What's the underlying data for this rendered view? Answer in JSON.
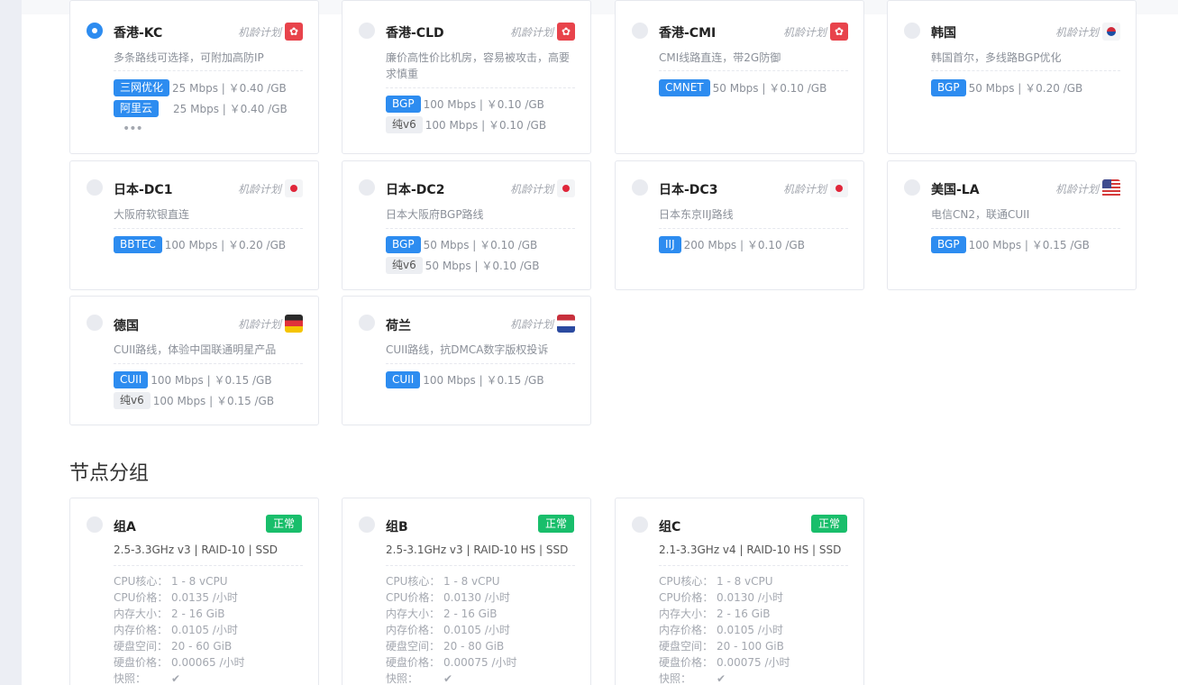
{
  "plan_label": "机龄计划",
  "flag_hk_glyph": "✿",
  "regions": [
    {
      "name": "香港-KC",
      "flag": "hk-flag-icon",
      "selected": true,
      "desc": "多条路线可选择，可附加高防IP",
      "routes": [
        {
          "tag": "三网优化",
          "style": "blue",
          "text": "25 Mbps | ￥0.40 /GB"
        },
        {
          "tag": "阿里云",
          "style": "blue",
          "text": "25 Mbps | ￥0.40 /GB"
        }
      ],
      "more": "•••"
    },
    {
      "name": "香港-CLD",
      "flag": "hk-flag-icon",
      "selected": false,
      "desc": "廉价高性价比机房，容易被攻击，高要求慎重",
      "routes": [
        {
          "tag": "BGP",
          "style": "blue",
          "text": "100 Mbps | ￥0.10 /GB"
        },
        {
          "tag": "纯v6",
          "style": "grey",
          "text": "100 Mbps | ￥0.10 /GB"
        }
      ]
    },
    {
      "name": "香港-CMI",
      "flag": "hk-flag-icon",
      "selected": false,
      "desc": "CMI线路直连，带2G防御",
      "routes": [
        {
          "tag": "CMNET",
          "style": "blue",
          "text": "50 Mbps | ￥0.10 /GB"
        }
      ]
    },
    {
      "name": "韩国",
      "flag": "kr-flag-icon",
      "selected": false,
      "desc": "韩国首尔，多线路BGP优化",
      "routes": [
        {
          "tag": "BGP",
          "style": "blue",
          "text": "50 Mbps | ￥0.20 /GB"
        }
      ]
    },
    {
      "name": "日本-DC1",
      "flag": "jp-flag-icon",
      "selected": false,
      "desc": "大阪府软银直连",
      "routes": [
        {
          "tag": "BBTEC",
          "style": "blue",
          "text": "100 Mbps | ￥0.20 /GB"
        }
      ]
    },
    {
      "name": "日本-DC2",
      "flag": "jp-flag-icon",
      "selected": false,
      "desc": "日本大阪府BGP路线",
      "routes": [
        {
          "tag": "BGP",
          "style": "blue",
          "text": "50 Mbps | ￥0.10 /GB"
        },
        {
          "tag": "纯v6",
          "style": "grey",
          "text": "50 Mbps | ￥0.10 /GB"
        }
      ]
    },
    {
      "name": "日本-DC3",
      "flag": "jp-flag-icon",
      "selected": false,
      "desc": "日本东京IIJ路线",
      "routes": [
        {
          "tag": "IIJ",
          "style": "blue",
          "text": "200 Mbps | ￥0.10 /GB"
        }
      ]
    },
    {
      "name": "美国-LA",
      "flag": "us-flag-icon",
      "selected": false,
      "desc": "电信CN2，联通CUII",
      "routes": [
        {
          "tag": "BGP",
          "style": "blue",
          "text": "100 Mbps | ￥0.15 /GB"
        }
      ]
    },
    {
      "name": "德国",
      "flag": "de-flag-icon",
      "selected": false,
      "desc": "CUII路线，体验中国联通明星产品",
      "routes": [
        {
          "tag": "CUII",
          "style": "blue",
          "text": "100 Mbps | ￥0.15 /GB"
        },
        {
          "tag": "纯v6",
          "style": "grey",
          "text": "100 Mbps | ￥0.15 /GB"
        }
      ]
    },
    {
      "name": "荷兰",
      "flag": "nl-flag-icon",
      "selected": false,
      "desc": "CUII路线，抗DMCA数字版权投诉",
      "routes": [
        {
          "tag": "CUII",
          "style": "blue",
          "text": "100 Mbps | ￥0.15 /GB"
        }
      ]
    }
  ],
  "node_section_title": "节点分组",
  "groups": [
    {
      "name": "组A",
      "status": "正常",
      "spec": "2.5-3.3GHz v3 | RAID-10 | SSD",
      "rows": [
        [
          "CPU核心：",
          "1 - 8 vCPU"
        ],
        [
          "CPU价格：",
          "0.0135 /小时"
        ],
        [
          "内存大小：",
          "2 - 16 GiB"
        ],
        [
          "内存价格：",
          "0.0105 /小时"
        ],
        [
          "硬盘空间：",
          "20 - 60 GiB"
        ],
        [
          "硬盘价格：",
          "0.00065 /小时"
        ],
        [
          "快照：",
          "✔"
        ]
      ]
    },
    {
      "name": "组B",
      "status": "正常",
      "spec": "2.5-3.1GHz v3 | RAID-10 HS | SSD",
      "rows": [
        [
          "CPU核心：",
          "1 - 8 vCPU"
        ],
        [
          "CPU价格：",
          "0.0130 /小时"
        ],
        [
          "内存大小：",
          "2 - 16 GiB"
        ],
        [
          "内存价格：",
          "0.0105 /小时"
        ],
        [
          "硬盘空间：",
          "20 - 80 GiB"
        ],
        [
          "硬盘价格：",
          "0.00075 /小时"
        ],
        [
          "快照：",
          "✔"
        ]
      ]
    },
    {
      "name": "组C",
      "status": "正常",
      "spec": "2.1-3.3GHz v4 | RAID-10 HS | SSD",
      "rows": [
        [
          "CPU核心：",
          "1 - 8 vCPU"
        ],
        [
          "CPU价格：",
          "0.0130 /小时"
        ],
        [
          "内存大小：",
          "2 - 16 GiB"
        ],
        [
          "内存价格：",
          "0.0105 /小时"
        ],
        [
          "硬盘空间：",
          "20 - 100 GiB"
        ],
        [
          "硬盘价格：",
          "0.00075 /小时"
        ],
        [
          "快照：",
          "✔"
        ]
      ]
    }
  ]
}
